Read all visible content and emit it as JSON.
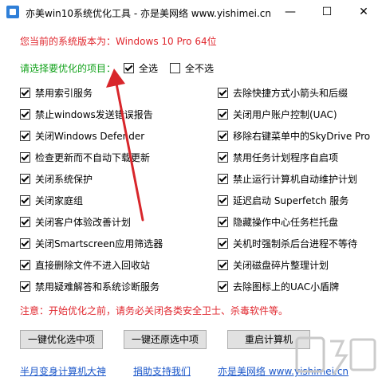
{
  "window": {
    "title": "亦美win10系统优化工具 - 亦是美网络 www.yishimei.cn",
    "minimize_glyph": "—",
    "maximize_glyph": "☐",
    "close_glyph": "✕"
  },
  "version_line": "您当前的系统版本为：Windows 10 Pro  64位",
  "select_label": "请选择要优化的项目：",
  "select_all": {
    "label": "全选",
    "checked": true
  },
  "select_none": {
    "label": "全不选",
    "checked": false
  },
  "options_left": [
    {
      "label": "禁用索引服务",
      "checked": true
    },
    {
      "label": "禁止windows发送错误报告",
      "checked": true
    },
    {
      "label": "关闭Windows Defender",
      "checked": true
    },
    {
      "label": "检查更新而不自动下载更新",
      "checked": true
    },
    {
      "label": "关闭系统保护",
      "checked": true
    },
    {
      "label": "关闭家庭组",
      "checked": true
    },
    {
      "label": "关闭客户体验改善计划",
      "checked": true
    },
    {
      "label": "关闭Smartscreen应用筛选器",
      "checked": true
    },
    {
      "label": "直接删除文件不进入回收站",
      "checked": true
    },
    {
      "label": "禁用疑难解答和系统诊断服务",
      "checked": true
    }
  ],
  "options_right": [
    {
      "label": "去除快捷方式小箭头和后缀",
      "checked": true
    },
    {
      "label": "关闭用户账户控制(UAC)",
      "checked": true
    },
    {
      "label": "移除右键菜单中的SkyDrive Pro",
      "checked": true
    },
    {
      "label": "禁用任务计划程序自启项",
      "checked": true
    },
    {
      "label": "禁止运行计算机自动维护计划",
      "checked": true
    },
    {
      "label": "延迟启动 Superfetch 服务",
      "checked": true
    },
    {
      "label": "隐藏操作中心任务栏托盘",
      "checked": true
    },
    {
      "label": "关机时强制杀后台进程不等待",
      "checked": true
    },
    {
      "label": "关闭磁盘碎片整理计划",
      "checked": true
    },
    {
      "label": "去除图标上的UAC小盾牌",
      "checked": true
    }
  ],
  "notice": "注意：开始优化之前，请务必关闭各类安全卫士、杀毒软件等。",
  "buttons": {
    "optimize": "一键优化选中项",
    "restore": "一键还原选中项",
    "restart": "重启计算机"
  },
  "links": {
    "left": "半月变身计算机大神",
    "middle": "捐助支持我们",
    "right": "亦是美网络 www.yishimei.cn"
  },
  "colors": {
    "notice_red": "#e0262d",
    "select_green": "#12a21b",
    "link_blue": "#1a56c9",
    "arrow_red": "#d8262b"
  }
}
